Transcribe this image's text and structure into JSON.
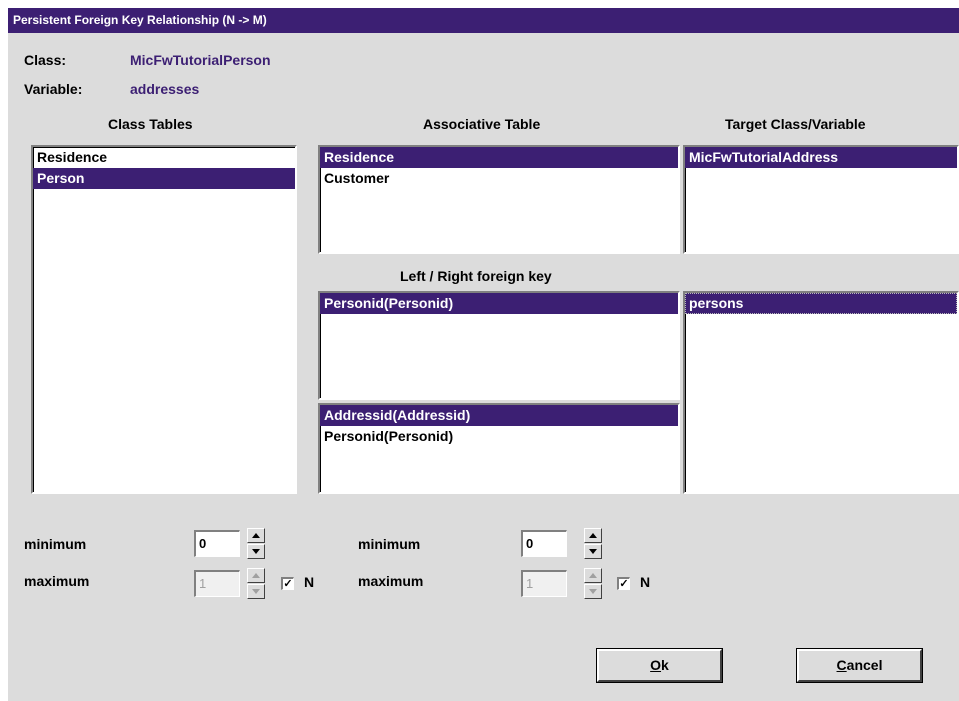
{
  "window": {
    "title": "Persistent Foreign Key Relationship (N -> M)"
  },
  "header": {
    "class_label": "Class:",
    "class_value": "MicFwTutorialPerson",
    "variable_label": "Variable:",
    "variable_value": "addresses"
  },
  "sections": {
    "class_tables": "Class Tables",
    "associative_table": "Associative Table",
    "target_class_variable": "Target Class/Variable",
    "foreign_key": "Left / Right foreign key"
  },
  "class_tables": {
    "items": [
      "Residence",
      "Person"
    ],
    "selected": "Person"
  },
  "associative_table": {
    "items": [
      "Residence",
      "Customer"
    ],
    "selected": "Residence"
  },
  "target_class": {
    "items": [
      "MicFwTutorialAddress"
    ],
    "selected": "MicFwTutorialAddress"
  },
  "left_foreign_key": {
    "items": [
      "Personid(Personid)"
    ],
    "selected": "Personid(Personid)"
  },
  "right_foreign_key": {
    "items": [
      "Addressid(Addressid)",
      "Personid(Personid)"
    ],
    "selected": "Addressid(Addressid)"
  },
  "target_variable": {
    "items": [
      "persons"
    ],
    "selected": "persons"
  },
  "left_cardinality": {
    "minimum_label": "minimum",
    "minimum_value": "0",
    "maximum_label": "maximum",
    "maximum_value": "1",
    "n_label": "N",
    "n_checked": true,
    "n_mark": "✓"
  },
  "right_cardinality": {
    "minimum_label": "minimum",
    "minimum_value": "0",
    "maximum_label": "maximum",
    "maximum_value": "1",
    "n_label": "N",
    "n_checked": true,
    "n_mark": "✓"
  },
  "buttons": {
    "ok_mnemonic": "O",
    "ok_rest": "k",
    "cancel_mnemonic": "C",
    "cancel_rest": "ancel"
  },
  "colors": {
    "accent": "#3c1f73",
    "dialog_bg": "#dcdcdc"
  }
}
